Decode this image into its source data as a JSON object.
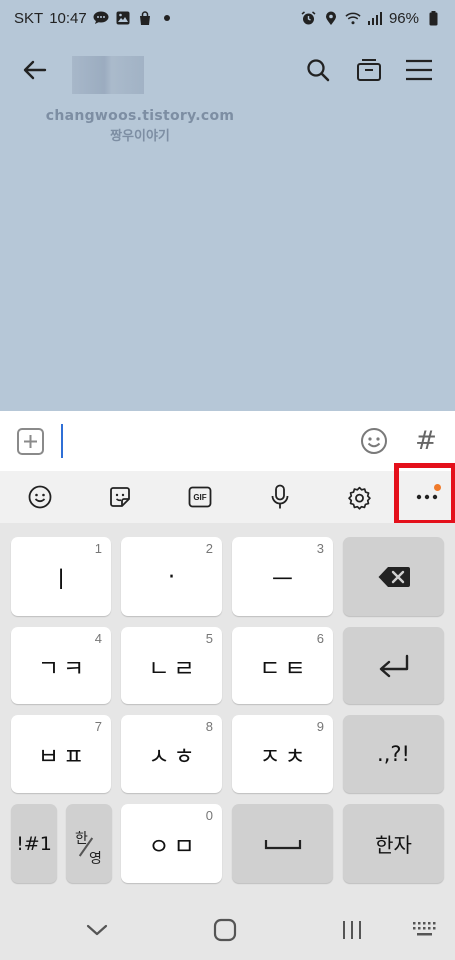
{
  "status_bar": {
    "carrier": "SKT",
    "time": "10:47",
    "battery": "96%",
    "icons_left": [
      "chat-icon",
      "gallery-icon",
      "bag-icon",
      "dot-icon"
    ],
    "icons_right": [
      "alarm-icon",
      "location-icon",
      "wifi-icon",
      "signal-icon",
      "battery-icon"
    ]
  },
  "header": {
    "back_icon": "arrow-left-icon",
    "actions": [
      "search-icon",
      "drawer-icon",
      "menu-icon"
    ]
  },
  "watermark": {
    "line1": "changwoos.tistory.com",
    "line2": "짱우이야기"
  },
  "input_bar": {
    "value": "",
    "hash": "#",
    "left_icon": "plus-box-icon",
    "emoji_icon": "emoji-icon"
  },
  "kb_toolbar": {
    "icons": [
      "emoji-icon",
      "sticker-icon",
      "gif-icon",
      "mic-icon",
      "settings-icon",
      "more-icon"
    ],
    "gif_label": "GIF",
    "highlight_color": "#e4101b",
    "badge_color": "#f07a2a"
  },
  "keyboard": {
    "rows": [
      [
        {
          "label": "ㅣ",
          "num": "1"
        },
        {
          "label": "·",
          "num": "2"
        },
        {
          "label": "ㅡ",
          "num": "3"
        }
      ],
      [
        {
          "label": "ㄱㅋ",
          "num": "4"
        },
        {
          "label": "ㄴㄹ",
          "num": "5"
        },
        {
          "label": "ㄷㅌ",
          "num": "6"
        }
      ],
      [
        {
          "label": "ㅂㅍ",
          "num": "7"
        },
        {
          "label": "ㅅㅎ",
          "num": "8"
        },
        {
          "label": "ㅈㅊ",
          "num": "9"
        }
      ]
    ],
    "punct": ".,?!",
    "symbols": "!#1",
    "han": "한",
    "yeong": "영",
    "zero_label": "ㅇㅁ",
    "zero_num": "0",
    "hanja": "한자",
    "backspace_icon": "backspace-icon",
    "enter_icon": "enter-icon",
    "space_icon": "space-icon"
  },
  "nav": [
    "chevron-down-icon",
    "home-icon",
    "recents-icon",
    "keyboard-icon"
  ],
  "colors": {
    "chat_background": "#b6c7d7",
    "keyboard_background": "#e6e6e6",
    "key": "#ffffff",
    "key_dark": "#d0d0d0",
    "cursor": "#2f6fd6"
  }
}
